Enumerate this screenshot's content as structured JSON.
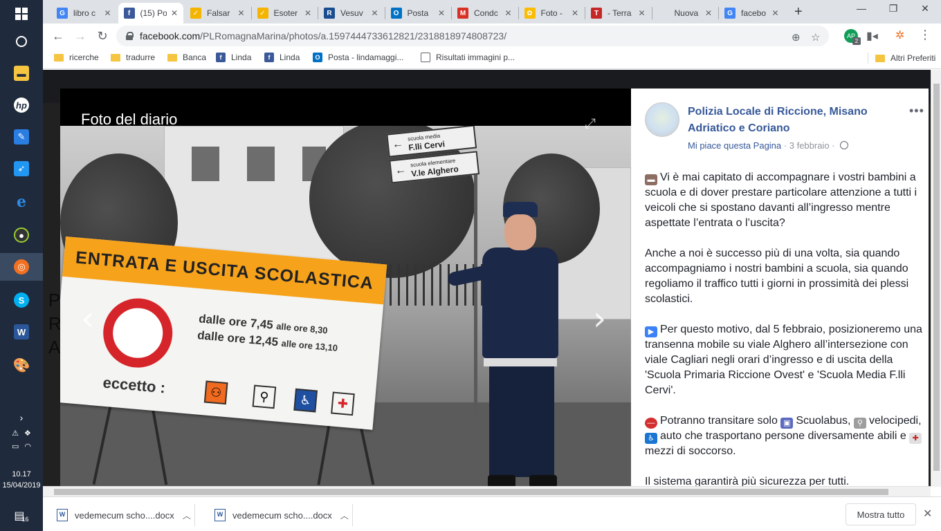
{
  "taskbar": {
    "time": "10.17",
    "date": "15/04/2019",
    "notifications_count": "16"
  },
  "tabs": [
    {
      "title": "libro c",
      "favicon": "G",
      "color": "#4285f4"
    },
    {
      "title": "(15) Po",
      "favicon": "f",
      "color": "#3b5998"
    },
    {
      "title": "Falsar",
      "favicon": "✓",
      "color": "#f4b400"
    },
    {
      "title": "Esoter",
      "favicon": "✓",
      "color": "#f4b400"
    },
    {
      "title": "Vesuv",
      "favicon": "R",
      "color": "#1a4d8f"
    },
    {
      "title": "Posta",
      "favicon": "O",
      "color": "#0072c6"
    },
    {
      "title": "Condc",
      "favicon": "M",
      "color": "#d93025"
    },
    {
      "title": "Foto -",
      "favicon": "✿",
      "color": "#fbbc04"
    },
    {
      "title": "- Terra",
      "favicon": "T",
      "color": "#c62828"
    },
    {
      "title": "Nuova sch",
      "favicon": "",
      "color": "#dee1e6"
    },
    {
      "title": "facebo",
      "favicon": "G",
      "color": "#4285f4"
    }
  ],
  "address": {
    "host": "facebook.com",
    "path": "/PLRomagnaMarina/photos/a.1597444733612821/2318818974808723/",
    "profile_badge": "2"
  },
  "bookmarks": [
    {
      "label": "ricerche",
      "type": "folder"
    },
    {
      "label": "tradurre",
      "type": "folder"
    },
    {
      "label": "Banca",
      "type": "folder"
    },
    {
      "label": "Linda",
      "type": "fb"
    },
    {
      "label": "Linda",
      "type": "fb"
    },
    {
      "label": "Posta - lindamaggi...",
      "type": "outlook"
    },
    {
      "label": "Risultati immagini p...",
      "type": "page"
    }
  ],
  "other_bookmarks": "Altri Preferiti",
  "photo": {
    "title": "Foto del diario",
    "sign_heading": "ENTRATA E USCITA SCOLASTICA",
    "hours_line1_a": "dalle ore 7,45",
    "hours_line1_b": "alle ore 8,30",
    "hours_line2_a": "dalle ore 12,45",
    "hours_line2_b": "alle ore 13,10",
    "except_label": "eccetto :",
    "street_sign_1": "F.lli Cervi",
    "street_sign_1_top": "scuola media",
    "street_sign_2": "V.le Alghero",
    "street_sign_2_top": "scuola elementare"
  },
  "post": {
    "page_name": "Polizia Locale di Riccione, Misano Adriatico e Coriano",
    "like_page": "Mi piace questa Pagina",
    "date": "3 febbraio",
    "paragraphs": [
      "Vi è mai capitato di accompagnare i vostri bambini a scuola e di dover prestare particolare attenzione a tutti i veicoli che si spostano davanti all’ingresso mentre aspettate l’entrata o l’uscita?",
      "Anche a noi è successo più di una volta, sia quando accompagniamo i nostri bambini a scuola, sia quando regoliamo il traffico tutti i giorni in prossimità dei plessi scolastici.",
      "Per questo motivo, dal 5 febbraio, posizioneremo una transenna mobile su viale Alghero all’intersezione con viale Cagliari negli orari d’ingresso e di uscita della 'Scuola Primaria Riccione Ovest' e 'Scuola Media F.lli Cervi'.",
      "Potranno transitare solo",
      "Il sistema garantirà più sicurezza per tutti."
    ],
    "p4_parts": [
      "Scuolabus,",
      "velocipedi,",
      "auto che trasportano persone diversamente abili e",
      "mezzi di soccorso."
    ]
  },
  "downloads": [
    {
      "name": "vedemecum scho....docx"
    },
    {
      "name": "vedemecum scho....docx"
    }
  ],
  "show_all": "Mostra tutto"
}
